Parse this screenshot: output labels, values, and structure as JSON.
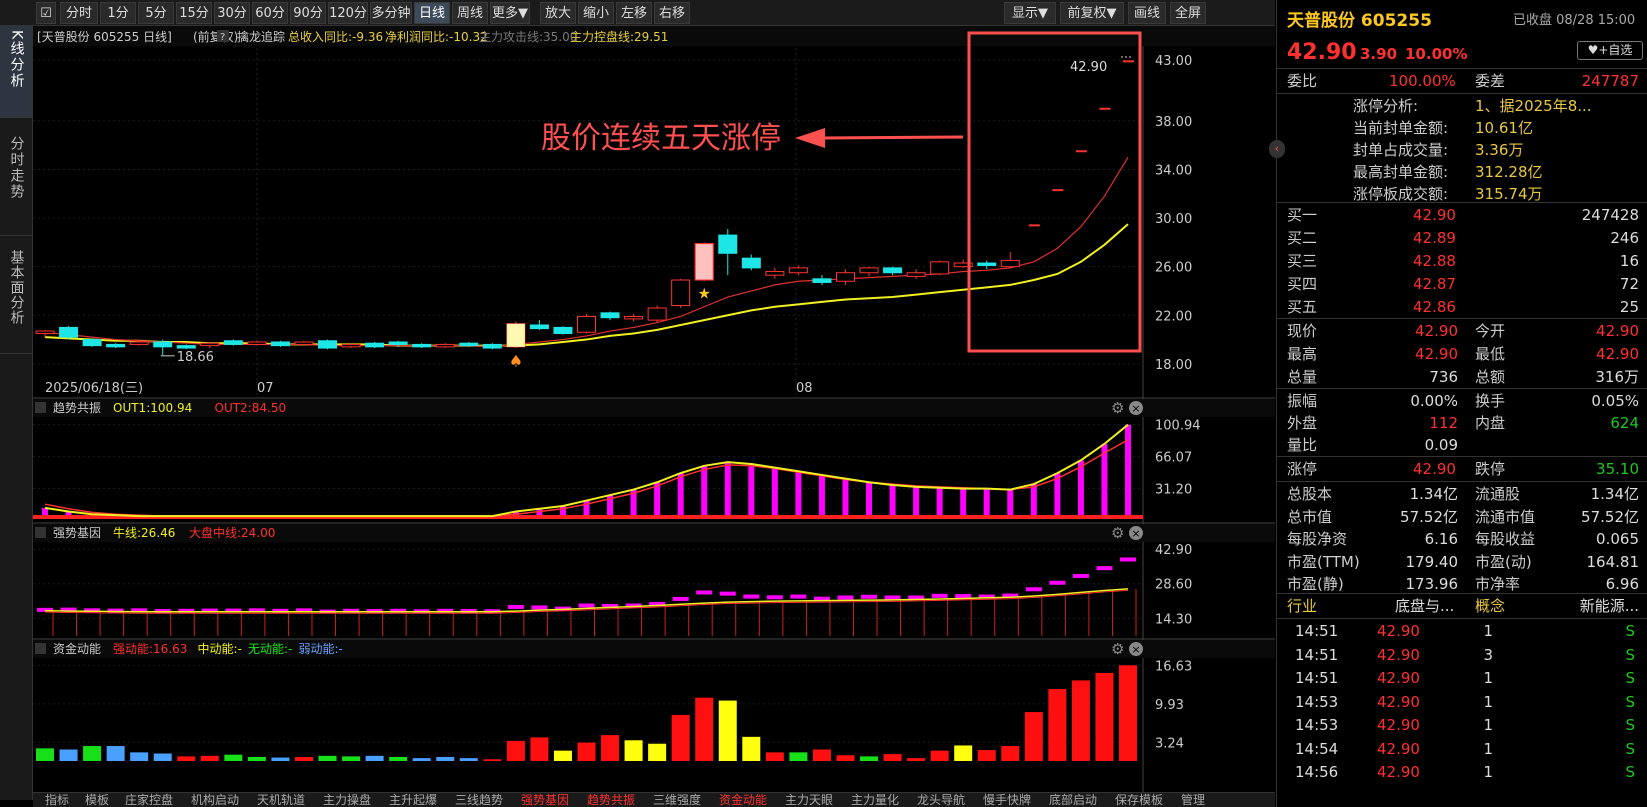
{
  "toolbar": {
    "buttons": [
      "分时",
      "1分",
      "5分",
      "15分",
      "30分",
      "60分",
      "90分",
      "120分",
      "多分钟",
      "日线",
      "周线",
      "更多▼",
      "放大",
      "缩小",
      "左移",
      "右移"
    ],
    "right_buttons": [
      "显示▼",
      "前复权▼",
      "画线",
      "全屏"
    ]
  },
  "left_tabs": [
    "K线分析",
    "分时走势",
    "基本面分析"
  ],
  "main_panel": {
    "title": "[天普股份 605255 日线]",
    "adjust": "(前复权)",
    "help": "?",
    "indicator_name": "擒龙追踪",
    "revenue_yoy": "总收入同比:-9.36",
    "profit_yoy": "净利润同比:-10.32",
    "main_attack": "主力攻击线:35.00",
    "main_control": "主力控盘线:29.51",
    "annotation": "股价连续五天涨停",
    "start_date": "2025/06/18(三)",
    "month_labels": [
      "07",
      "08"
    ],
    "low_label": "18.66",
    "high_label": "42.90"
  },
  "panel2": {
    "name": "趋势共振",
    "out1": "OUT1:100.94",
    "out2": "OUT2:84.50",
    "y_labels": [
      "100.94",
      "66.07",
      "31.20"
    ]
  },
  "panel3": {
    "name": "强势基因",
    "bull": "牛线:26.46",
    "market": "大盘中线:24.00",
    "y_labels": [
      "42.90",
      "28.60",
      "14.30"
    ]
  },
  "panel4": {
    "name": "资金动能",
    "strong": "强动能:16.63",
    "mid": "中动能:-",
    "none": "无动能:-",
    "weak": "弱动能:-",
    "y_labels": [
      "16.63",
      "9.93",
      "3.24"
    ]
  },
  "bottom_tabs": [
    "指标",
    "模板",
    "庄家控盘",
    "机构启动",
    "天机轨道",
    "主力操盘",
    "主升起爆",
    "三线趋势",
    "强势基因",
    "趋势共振",
    "三维强度",
    "资金动能",
    "主力天眼",
    "主力量化",
    "龙头导航",
    "慢手快牌",
    "底部启动",
    "保存模板",
    "管理"
  ],
  "colors": {
    "up": "#ff3232",
    "down": "#1ee6e6",
    "ma_red": "#e03030",
    "ma_yellow": "#f0f020",
    "magenta": "#ff00ff",
    "annotation": "#ff5050"
  },
  "chart_data": {
    "type": "candlestick",
    "ylim": [
      17,
      44
    ],
    "y_ticks": [
      43.0,
      38.0,
      34.0,
      30.0,
      26.0,
      22.0,
      18.0
    ],
    "candles": [
      [
        20.5,
        20.7,
        20.2,
        20.8
      ],
      [
        21.0,
        20.2,
        20.0,
        21.1
      ],
      [
        20.0,
        19.5,
        19.4,
        20.1
      ],
      [
        19.6,
        19.4,
        19.3,
        19.7
      ],
      [
        19.6,
        19.8,
        19.5,
        19.9
      ],
      [
        19.8,
        19.4,
        18.7,
        20.0
      ],
      [
        19.5,
        19.3,
        19.2,
        19.6
      ],
      [
        19.5,
        19.7,
        19.3,
        19.8
      ],
      [
        19.9,
        19.6,
        19.5,
        20.0
      ],
      [
        19.6,
        19.8,
        19.5,
        19.9
      ],
      [
        19.8,
        19.5,
        19.4,
        19.9
      ],
      [
        19.6,
        19.8,
        19.5,
        19.9
      ],
      [
        19.9,
        19.3,
        19.2,
        20.0
      ],
      [
        19.4,
        19.6,
        19.3,
        19.7
      ],
      [
        19.7,
        19.4,
        19.3,
        19.8
      ],
      [
        19.8,
        19.6,
        19.4,
        19.9
      ],
      [
        19.6,
        19.4,
        19.3,
        19.7
      ],
      [
        19.4,
        19.6,
        19.3,
        19.7
      ],
      [
        19.7,
        19.5,
        19.4,
        19.8
      ],
      [
        19.6,
        19.3,
        19.2,
        19.7
      ],
      [
        19.4,
        21.3,
        19.3,
        21.5
      ],
      [
        21.2,
        20.9,
        20.8,
        21.6
      ],
      [
        21.0,
        20.5,
        20.4,
        21.1
      ],
      [
        20.6,
        21.9,
        20.5,
        22.1
      ],
      [
        22.2,
        21.8,
        21.6,
        22.3
      ],
      [
        21.7,
        21.9,
        21.5,
        22.1
      ],
      [
        21.6,
        22.6,
        21.4,
        22.8
      ],
      [
        22.8,
        24.9,
        22.6,
        25.0
      ],
      [
        24.9,
        27.9,
        24.8,
        28.0
      ],
      [
        28.6,
        27.1,
        25.3,
        29.1
      ],
      [
        26.7,
        25.9,
        25.7,
        27.0
      ],
      [
        25.3,
        25.6,
        25.0,
        25.9
      ],
      [
        25.5,
        25.9,
        25.3,
        26.1
      ],
      [
        25.0,
        24.7,
        24.5,
        25.3
      ],
      [
        24.8,
        25.5,
        24.5,
        25.8
      ],
      [
        25.5,
        25.9,
        25.2,
        26.0
      ],
      [
        25.9,
        25.5,
        25.3,
        26.0
      ],
      [
        25.2,
        25.5,
        25.0,
        25.8
      ],
      [
        25.4,
        26.4,
        25.3,
        26.5
      ],
      [
        26.0,
        26.3,
        25.9,
        26.6
      ],
      [
        26.3,
        26.1,
        25.8,
        26.5
      ],
      [
        26.0,
        26.5,
        25.9,
        27.2
      ],
      [
        29.4,
        29.4,
        29.4,
        29.4
      ],
      [
        32.3,
        32.3,
        32.3,
        32.3
      ],
      [
        35.5,
        35.5,
        35.5,
        35.5
      ],
      [
        39.0,
        39.0,
        39.0,
        39.0
      ],
      [
        42.9,
        42.9,
        42.9,
        42.9
      ]
    ],
    "ma_red": [
      20.6,
      20.4,
      20.2,
      20.0,
      19.9,
      19.8,
      19.7,
      19.6,
      19.6,
      19.6,
      19.6,
      19.6,
      19.5,
      19.5,
      19.5,
      19.5,
      19.5,
      19.5,
      19.5,
      19.4,
      19.6,
      19.8,
      20.0,
      20.3,
      20.7,
      21.0,
      21.4,
      21.9,
      22.7,
      23.5,
      24.0,
      24.5,
      24.8,
      24.9,
      25.0,
      25.1,
      25.2,
      25.3,
      25.4,
      25.6,
      25.7,
      25.9,
      26.4,
      27.5,
      29.3,
      31.8,
      35.0
    ],
    "ma_yellow": [
      20.2,
      20.1,
      20.0,
      19.9,
      19.9,
      19.8,
      19.8,
      19.7,
      19.7,
      19.7,
      19.6,
      19.6,
      19.6,
      19.6,
      19.6,
      19.5,
      19.5,
      19.5,
      19.5,
      19.5,
      19.5,
      19.6,
      19.8,
      20.0,
      20.3,
      20.5,
      20.8,
      21.2,
      21.6,
      22.0,
      22.4,
      22.7,
      22.9,
      23.1,
      23.3,
      23.4,
      23.5,
      23.7,
      23.9,
      24.1,
      24.3,
      24.5,
      24.9,
      25.4,
      26.4,
      27.8,
      29.5
    ],
    "trend_out1": [
      10,
      6,
      3,
      2,
      1,
      1,
      1,
      1,
      1,
      1,
      1,
      1,
      1,
      1,
      1,
      1,
      1,
      1,
      1,
      1,
      6,
      9,
      12,
      18,
      24,
      30,
      38,
      48,
      56,
      60,
      58,
      54,
      50,
      46,
      42,
      38,
      35,
      33,
      32,
      31,
      31,
      30,
      36,
      48,
      62,
      80,
      100.94
    ],
    "trend_out2": [
      14,
      9,
      5,
      3,
      2,
      1,
      1,
      1,
      1,
      1,
      1,
      1,
      1,
      1,
      1,
      1,
      1,
      1,
      1,
      1,
      3,
      6,
      9,
      14,
      20,
      26,
      34,
      44,
      52,
      57,
      56,
      53,
      49,
      45,
      41,
      38,
      36,
      34,
      33,
      32,
      31,
      30,
      33,
      42,
      55,
      70,
      84.5
    ],
    "gene_bull": [
      17.5,
      17.3,
      17.2,
      17.1,
      17.0,
      17.0,
      17.0,
      17.0,
      17.0,
      17.0,
      17.0,
      17.0,
      17.0,
      17.0,
      17.0,
      17.0,
      17.0,
      17.0,
      17.0,
      17.0,
      17.3,
      17.7,
      18.0,
      18.4,
      18.8,
      19.2,
      19.6,
      20.1,
      20.6,
      21.0,
      21.2,
      21.4,
      21.5,
      21.6,
      21.7,
      21.8,
      21.9,
      22.1,
      22.3,
      22.5,
      22.8,
      23.0,
      23.5,
      24.2,
      25.0,
      25.8,
      26.46
    ],
    "gene_bars": [
      17.8,
      17.9,
      17.6,
      17.5,
      17.6,
      17.3,
      17.4,
      17.5,
      17.5,
      17.6,
      17.4,
      17.6,
      17.1,
      17.4,
      17.3,
      17.4,
      17.2,
      17.4,
      17.3,
      17.2,
      19.0,
      18.8,
      18.3,
      19.6,
      19.4,
      19.6,
      20.2,
      22.3,
      25.0,
      24.5,
      23.3,
      23.0,
      23.3,
      22.4,
      22.9,
      23.2,
      22.9,
      22.9,
      23.6,
      23.5,
      23.3,
      23.7,
      26.3,
      29.0,
      31.8,
      35.0,
      38.6
    ],
    "fund_bars": [
      2.2,
      2.0,
      2.6,
      2.6,
      1.5,
      1.3,
      0.8,
      0.9,
      1.1,
      0.7,
      0.6,
      0.7,
      0.9,
      0.8,
      0.9,
      0.7,
      0.5,
      0.7,
      0.5,
      0.3,
      3.5,
      4.1,
      1.8,
      3.2,
      4.5,
      3.6,
      3.0,
      8.0,
      11.0,
      10.5,
      4.2,
      1.5,
      1.5,
      2.0,
      1.0,
      0.8,
      1.2,
      0.5,
      1.8,
      2.7,
      1.9,
      2.6,
      8.5,
      12.5,
      14.0,
      15.3,
      16.63
    ],
    "fund_colors": [
      "g",
      "b",
      "g",
      "b",
      "b",
      "b",
      "r",
      "r",
      "g",
      "g",
      "b",
      "r",
      "g",
      "g",
      "b",
      "g",
      "b",
      "b",
      "b",
      "r",
      "r",
      "r",
      "y",
      "r",
      "r",
      "y",
      "y",
      "r",
      "r",
      "y",
      "y",
      "r",
      "g",
      "r",
      "r",
      "g",
      "r",
      "r",
      "r",
      "y",
      "r",
      "r",
      "r",
      "r",
      "r",
      "r",
      "r"
    ]
  },
  "right": {
    "name": "天普股份",
    "code": "605255",
    "status": "已收盘 08/28 15:00",
    "price": "42.90",
    "change": "3.90",
    "pct": "10.00%",
    "add_button": "+自选",
    "wei_bi_label": "委比",
    "wei_bi": "100.00%",
    "wei_cha_label": "委差",
    "wei_cha": "247787",
    "limit_rows": [
      {
        "k": "涨停分析:",
        "v": "1、据2025年8..."
      },
      {
        "k": "当前封单金额:",
        "v": "10.61亿"
      },
      {
        "k": "封单占成交量:",
        "v": "3.36万"
      },
      {
        "k": "最高封单金额:",
        "v": "312.28亿"
      },
      {
        "k": "涨停板成交额:",
        "v": "315.74万"
      }
    ],
    "book": [
      {
        "k": "买一",
        "p": "42.90",
        "v": "247428"
      },
      {
        "k": "买二",
        "p": "42.89",
        "v": "246"
      },
      {
        "k": "买三",
        "p": "42.88",
        "v": "16"
      },
      {
        "k": "买四",
        "p": "42.87",
        "v": "72"
      },
      {
        "k": "买五",
        "p": "42.86",
        "v": "25"
      }
    ],
    "quote": [
      {
        "k1": "现价",
        "v1": "42.90",
        "c1": "red",
        "k2": "今开",
        "v2": "42.90",
        "c2": "red"
      },
      {
        "k1": "最高",
        "v1": "42.90",
        "c1": "red",
        "k2": "最低",
        "v2": "42.90",
        "c2": "red"
      },
      {
        "k1": "总量",
        "v1": "736",
        "c1": "wht",
        "k2": "总额",
        "v2": "316万",
        "c2": "wht"
      }
    ],
    "quote2": [
      {
        "k1": "振幅",
        "v1": "0.00%",
        "c1": "wht",
        "k2": "换手",
        "v2": "0.05%",
        "c2": "wht"
      },
      {
        "k1": "外盘",
        "v1": "112",
        "c1": "red",
        "k2": "内盘",
        "v2": "624",
        "c2": "grn"
      },
      {
        "k1": "量比",
        "v1": "0.09",
        "c1": "wht",
        "k2": "",
        "v2": "",
        "c2": "wht"
      }
    ],
    "limit": {
      "k1": "涨停",
      "v1": "42.90",
      "k2": "跌停",
      "v2": "35.10"
    },
    "fund": [
      {
        "k1": "总股本",
        "v1": "1.34亿",
        "k2": "流通股",
        "v2": "1.34亿"
      },
      {
        "k1": "总市值",
        "v1": "57.52亿",
        "k2": "流通市值",
        "v2": "57.52亿"
      },
      {
        "k1": "每股净资",
        "v1": "6.16",
        "k2": "每股收益",
        "v2": "0.065"
      },
      {
        "k1": "市盈(TTM)",
        "v1": "179.40",
        "k2": "市盈(动)",
        "v2": "164.81"
      },
      {
        "k1": "市盈(静)",
        "v1": "173.96",
        "k2": "市净率",
        "v2": "6.96"
      }
    ],
    "industry": {
      "k1": "行业",
      "v1": "底盘与...",
      "k2": "概念",
      "v2": "新能源..."
    },
    "ticks": [
      {
        "t": "14:51",
        "p": "42.90",
        "v": "1",
        "s": "S"
      },
      {
        "t": "14:51",
        "p": "42.90",
        "v": "3",
        "s": "S"
      },
      {
        "t": "14:51",
        "p": "42.90",
        "v": "1",
        "s": "S"
      },
      {
        "t": "14:53",
        "p": "42.90",
        "v": "1",
        "s": "S"
      },
      {
        "t": "14:53",
        "p": "42.90",
        "v": "1",
        "s": "S"
      },
      {
        "t": "14:54",
        "p": "42.90",
        "v": "1",
        "s": "S"
      },
      {
        "t": "14:56",
        "p": "42.90",
        "v": "1",
        "s": "S"
      }
    ]
  }
}
